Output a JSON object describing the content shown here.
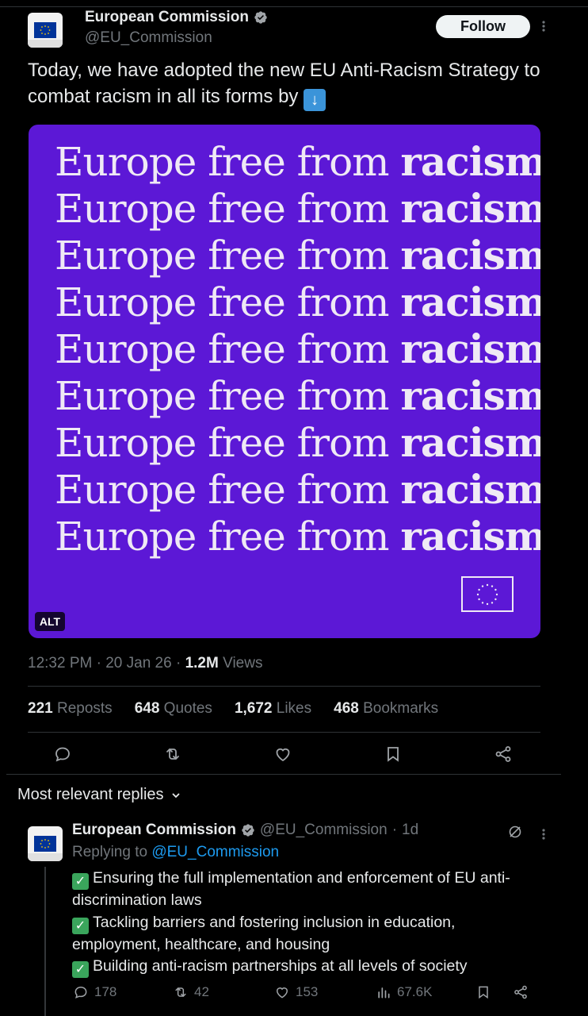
{
  "post": {
    "author_name": "European Commission",
    "author_handle": "@EU_Commission",
    "follow_label": "Follow",
    "text": "Today, we have adopted the new EU Anti-Racism Strategy to combat racism in all its forms by",
    "media": {
      "line_prefix": "Europe free from ",
      "line_bold": "racism",
      "alt_label": "ALT"
    },
    "time": "12:32 PM",
    "date": "20 Jan 26",
    "views_count": "1.2M",
    "views_label": "Views",
    "stats": [
      {
        "count": "221",
        "label": "Reposts"
      },
      {
        "count": "648",
        "label": "Quotes"
      },
      {
        "count": "1,672",
        "label": "Likes"
      },
      {
        "count": "468",
        "label": "Bookmarks"
      }
    ]
  },
  "replies_section": {
    "sort_label": "Most relevant replies"
  },
  "reply": {
    "author_name": "European Commission",
    "author_handle": "@EU_Commission",
    "age": "1d",
    "replying_prefix": "Replying to",
    "replying_handle": "@EU_Commission",
    "items": [
      "Ensuring the full implementation and enforcement of EU anti-discrimination laws",
      "Tackling barriers and fostering inclusion in education, employment, healthcare, and housing",
      "Building anti-racism partnerships at all levels of society"
    ],
    "replies_count": "178",
    "reposts_count": "42",
    "likes_count": "153",
    "views_count": "67.6K"
  },
  "icons": {
    "verified": "verified-badge-icon",
    "more": "more-icon",
    "reply": "reply-icon",
    "repost": "repost-icon",
    "like": "like-icon",
    "bookmark": "bookmark-icon",
    "share": "share-icon",
    "views": "views-icon",
    "grok": "grok-icon",
    "chevron": "chevron-down-icon",
    "arrow": "down-arrow-emoji-icon",
    "check": "check-mark-emoji-icon"
  },
  "colors": {
    "background": "#000000",
    "media_purple": "#5c18d6",
    "link_blue": "#1d9bf0",
    "muted": "#71767b"
  }
}
